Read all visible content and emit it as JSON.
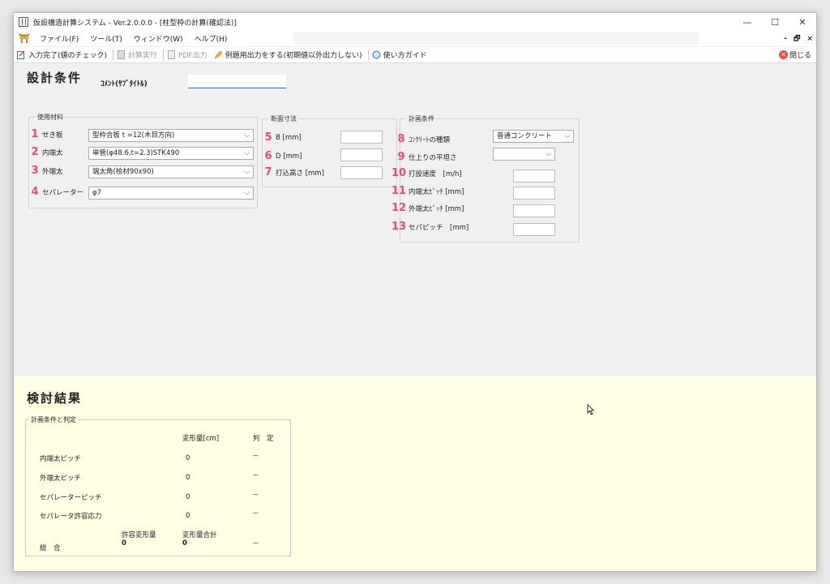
{
  "window": {
    "title": "仮設構造計算システム - Ver.2.0.0.0 - [柱型枠の計算(確認法)]",
    "controls": {
      "minimize": "—",
      "maximize": "☐",
      "close": "✕"
    }
  },
  "menu": {
    "items": [
      "ファイル(F)",
      "ツール(T)",
      "ウィンドウ(W)",
      "ヘルプ(H)"
    ],
    "mdi_controls": {
      "minimize": "-",
      "restore": "🗗",
      "close": "×"
    }
  },
  "toolbar": {
    "input_complete": "入力完了(値のチェック)",
    "calc_run": "計算実行",
    "pdf_output": "PDF出力",
    "example_output": "例題用出力をする(初期値以外出力しない)",
    "guide": "使い方ガイド",
    "close": "閉じる"
  },
  "design": {
    "title": "設計条件",
    "comment_label": "ｺﾒﾝﾄ(ｻﾌﾞﾀｲﾄﾙ)",
    "comment_value": "",
    "materials": {
      "legend": "使用材料",
      "rows": [
        {
          "num": "1",
          "label": "せき板",
          "value": "型枠合板 t =12(木目方向)"
        },
        {
          "num": "2",
          "label": "内端太",
          "value": "単管(φ48.6,t=2.3)STK490"
        },
        {
          "num": "3",
          "label": "外端太",
          "value": "端太角(桧材90x90)"
        },
        {
          "num": "4",
          "label": "セパレーター",
          "value": "φ7"
        }
      ]
    },
    "section": {
      "legend": "断面寸法",
      "rows": [
        {
          "num": "5",
          "label": "B [mm]",
          "value": ""
        },
        {
          "num": "6",
          "label": "D [mm]",
          "value": ""
        },
        {
          "num": "7",
          "label": "打込高さ [mm]",
          "value": ""
        }
      ]
    },
    "plan": {
      "legend": "計画条件",
      "rows": [
        {
          "num": "8",
          "label": "ｺﾝｸﾘｰﾄの種類",
          "value": "普通コンクリート"
        },
        {
          "num": "9",
          "label": "仕上りの平坦さ",
          "value": ""
        },
        {
          "num": "10",
          "label": "打設速度　[m/h]",
          "value": ""
        },
        {
          "num": "11",
          "label": "内端太ﾋﾟｯﾁ [mm]",
          "value": ""
        },
        {
          "num": "12",
          "label": "外端太ﾋﾟｯﾁ [mm]",
          "value": ""
        },
        {
          "num": "13",
          "label": "セパピッチ　[mm]",
          "value": ""
        }
      ]
    }
  },
  "results": {
    "title": "検討結果",
    "legend": "計画条件と判定",
    "header_deform": "変形量[cm]",
    "header_judge": "判　定",
    "rows": [
      {
        "label": "内端太ピッチ",
        "value": "0",
        "judge": "－"
      },
      {
        "label": "外端太ピッチ",
        "value": "0",
        "judge": "－"
      },
      {
        "label": "セパレーターピッチ",
        "value": "0",
        "judge": "－"
      },
      {
        "label": "セパレータ許容応力",
        "value": "0",
        "judge": "－"
      }
    ],
    "total": {
      "label": "総　合",
      "allow_header": "許容変形量",
      "sum_header": "変形量合計",
      "allow_value": "0",
      "sum_value": "0",
      "judge": "－"
    }
  }
}
